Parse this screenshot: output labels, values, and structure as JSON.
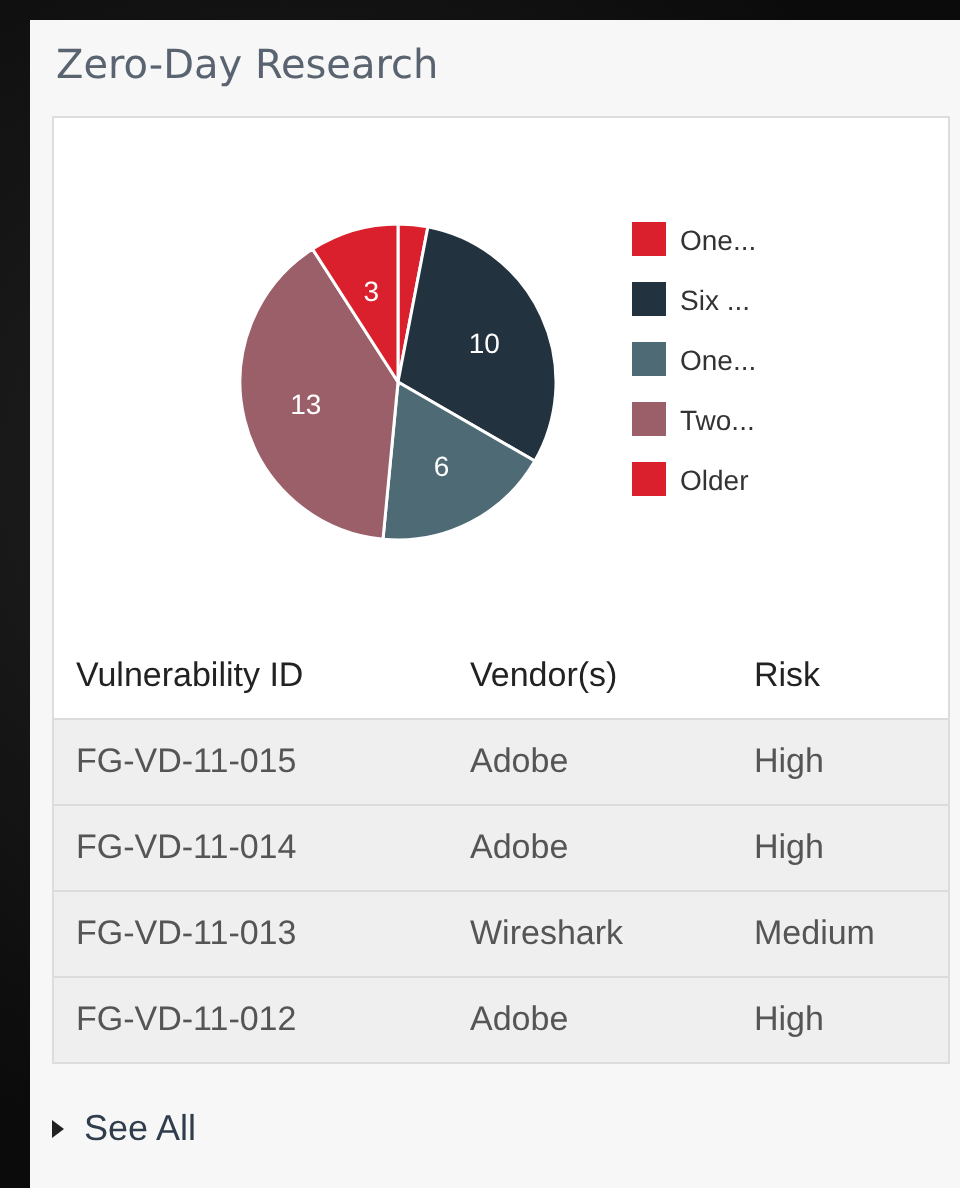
{
  "panel": {
    "title": "Zero-Day Research",
    "chart_data": {
      "type": "pie",
      "categories": [
        "One...",
        "Six ...",
        "One...",
        "Two...",
        "Older"
      ],
      "values": [
        1,
        10,
        6,
        13,
        3
      ],
      "colors": [
        "#d9202c",
        "#23323f",
        "#4e6a75",
        "#9a5f68",
        "#d9202c"
      ],
      "value_labels": [
        null,
        "10",
        "6",
        "13",
        "3"
      ],
      "legend": "right"
    },
    "table": {
      "columns": [
        "Vulnerability ID",
        "Vendor(s)",
        "Risk"
      ],
      "rows": [
        [
          "FG-VD-11-015",
          "Adobe",
          "High"
        ],
        [
          "FG-VD-11-014",
          "Adobe",
          "High"
        ],
        [
          "FG-VD-11-013",
          "Wireshark",
          "Medium"
        ],
        [
          "FG-VD-11-012",
          "Adobe",
          "High"
        ]
      ]
    },
    "link": "See All"
  }
}
